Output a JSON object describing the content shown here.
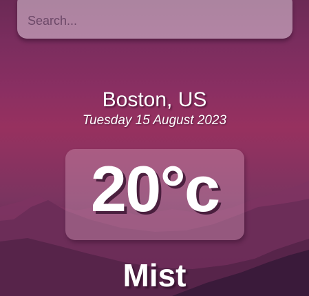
{
  "search": {
    "placeholder": "Search...",
    "value": ""
  },
  "weather": {
    "location": "Boston, US",
    "date": "Tuesday 15 August 2023",
    "temperature": "20°c",
    "condition": "Mist"
  },
  "colors": {
    "background_top": "#6b2a55",
    "background_mid": "#97315f",
    "background_bottom": "#3f1f44",
    "text": "#ffffff"
  }
}
